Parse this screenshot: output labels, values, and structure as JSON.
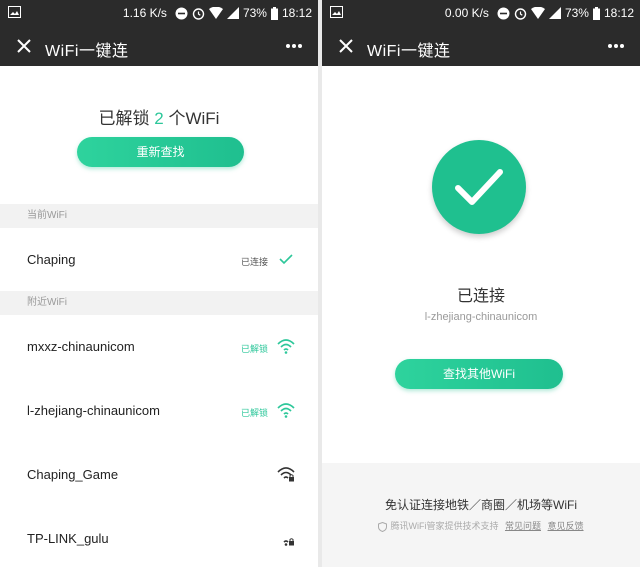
{
  "colors": {
    "accent": "#2dc79a",
    "topbar": "#2b2b2b",
    "section_bg": "#f2f2f2"
  },
  "left": {
    "status": {
      "speed": "1.16 K/s",
      "battery": "73%",
      "time": "18:12"
    },
    "title": "WiFi一键连",
    "unlock": {
      "prefix": "已解锁 ",
      "count": "2",
      "suffix": " 个WiFi"
    },
    "rescan_label": "重新查找",
    "current_section": "当前WiFi",
    "current": {
      "name": "Chaping",
      "status": "已连接",
      "icon": "check-icon"
    },
    "nearby_section": "附近WiFi",
    "nearby": [
      {
        "name": "mxxz-chinaunicom",
        "status": "已解锁",
        "icon": "wifi-icon"
      },
      {
        "name": "l-zhejiang-chinaunicom",
        "status": "已解锁",
        "icon": "wifi-icon"
      },
      {
        "name": "Chaping_Game",
        "status": "",
        "icon": "wifi-lock-icon"
      },
      {
        "name": "TP-LINK_gulu",
        "status": "",
        "icon": "wifi-lock-icon"
      }
    ]
  },
  "right": {
    "status": {
      "speed": "0.00 K/s",
      "battery": "73%",
      "time": "18:12"
    },
    "title": "WiFi一键连",
    "connected_label": "已连接",
    "ssid": "l-zhejiang-chinaunicom",
    "find_other_label": "查找其他WiFi",
    "footer": {
      "line1": "免认证连接地铁／商圈／机场等WiFi",
      "support": "腾讯WiFi管家提供技术支持",
      "faq": "常见问题",
      "feedback": "意见反馈"
    }
  }
}
